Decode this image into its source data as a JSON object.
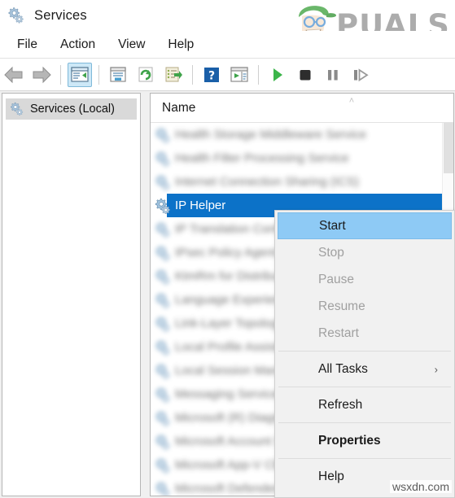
{
  "window": {
    "title": "Services",
    "icon": "services-gear-icon"
  },
  "watermark_logo": {
    "text": "PUALS",
    "full_name": "APPUALS",
    "mascot_color": "#4aa84a",
    "text_color": "#9b9b9b"
  },
  "menubar": {
    "items": [
      {
        "label": "File",
        "name": "menu-file"
      },
      {
        "label": "Action",
        "name": "menu-action"
      },
      {
        "label": "View",
        "name": "menu-view"
      },
      {
        "label": "Help",
        "name": "menu-help"
      }
    ]
  },
  "toolbar": {
    "buttons": [
      {
        "name": "back-button",
        "icon": "back-arrow-icon",
        "active": false
      },
      {
        "name": "forward-button",
        "icon": "forward-arrow-icon",
        "active": false
      },
      {
        "name": "show-hide-console-tree-button",
        "icon": "console-tree-icon",
        "active": true
      },
      {
        "name": "properties-button",
        "icon": "properties-window-icon",
        "active": false
      },
      {
        "name": "refresh-button",
        "icon": "refresh-circular-arrow-icon",
        "active": false
      },
      {
        "name": "export-list-button",
        "icon": "export-list-icon",
        "active": false
      },
      {
        "name": "help-button",
        "icon": "question-mark-help-icon",
        "active": false
      },
      {
        "name": "show-hide-action-pane-button",
        "icon": "action-pane-icon",
        "active": false
      },
      {
        "name": "start-service-button",
        "icon": "play-triangle-icon",
        "active": false
      },
      {
        "name": "stop-service-button",
        "icon": "stop-square-icon",
        "active": false
      },
      {
        "name": "pause-service-button",
        "icon": "pause-bars-icon",
        "active": false
      },
      {
        "name": "restart-service-button",
        "icon": "restart-bar-triangle-icon",
        "active": false
      }
    ]
  },
  "tree": {
    "root_label": "Services (Local)",
    "root_icon": "services-gear-icon"
  },
  "list": {
    "column_header": "Name",
    "sort_indicator": "˄",
    "rows": [
      {
        "label": "Health Storage Middleware Service",
        "blurred": true,
        "selected": false
      },
      {
        "label": "Health Filter Processing Service",
        "blurred": true,
        "selected": false
      },
      {
        "label": "Internet Connection Sharing (ICS)",
        "blurred": true,
        "selected": false
      },
      {
        "label": "IP Helper",
        "blurred": false,
        "selected": true
      },
      {
        "label": "IP Translation Configuration Service",
        "blurred": true,
        "selected": false
      },
      {
        "label": "IPsec Policy Agent",
        "blurred": true,
        "selected": false
      },
      {
        "label": "KtmRm for Distributed Transaction",
        "blurred": true,
        "selected": false
      },
      {
        "label": "Language Experience Service",
        "blurred": true,
        "selected": false
      },
      {
        "label": "Link-Layer Topology Discovery",
        "blurred": true,
        "selected": false
      },
      {
        "label": "Local Profile Assistant Service",
        "blurred": true,
        "selected": false
      },
      {
        "label": "Local Session Manager",
        "blurred": true,
        "selected": false
      },
      {
        "label": "Messaging Service",
        "blurred": true,
        "selected": false
      },
      {
        "label": "Microsoft (R) Diagnostics Hub",
        "blurred": true,
        "selected": false
      },
      {
        "label": "Microsoft Account Sign-in Assistant",
        "blurred": true,
        "selected": false
      },
      {
        "label": "Microsoft App-V Client",
        "blurred": true,
        "selected": false
      },
      {
        "label": "Microsoft Defender Antivirus Service",
        "blurred": true,
        "selected": false
      }
    ]
  },
  "context_menu": {
    "items": [
      {
        "label": "Start",
        "name": "ctx-start",
        "state": "highlight"
      },
      {
        "label": "Stop",
        "name": "ctx-stop",
        "state": "disabled"
      },
      {
        "label": "Pause",
        "name": "ctx-pause",
        "state": "disabled"
      },
      {
        "label": "Resume",
        "name": "ctx-resume",
        "state": "disabled"
      },
      {
        "label": "Restart",
        "name": "ctx-restart",
        "state": "disabled"
      },
      {
        "separator": true
      },
      {
        "label": "All Tasks",
        "name": "ctx-all-tasks",
        "state": "normal",
        "submenu": true,
        "submenu_arrow": "›"
      },
      {
        "separator": true
      },
      {
        "label": "Refresh",
        "name": "ctx-refresh",
        "state": "normal"
      },
      {
        "separator": true
      },
      {
        "label": "Properties",
        "name": "ctx-properties",
        "state": "bold"
      },
      {
        "separator": true
      },
      {
        "label": "Help",
        "name": "ctx-help",
        "state": "normal"
      }
    ]
  },
  "watermark": {
    "text": "wsxdn.com"
  },
  "colors": {
    "selection_blue": "#0c72c8",
    "highlight_blue": "#8ecaf5",
    "toolbar_active": "#cde8f7",
    "menu_bg": "#f1f1f1",
    "start_green": "#3cb54a"
  }
}
